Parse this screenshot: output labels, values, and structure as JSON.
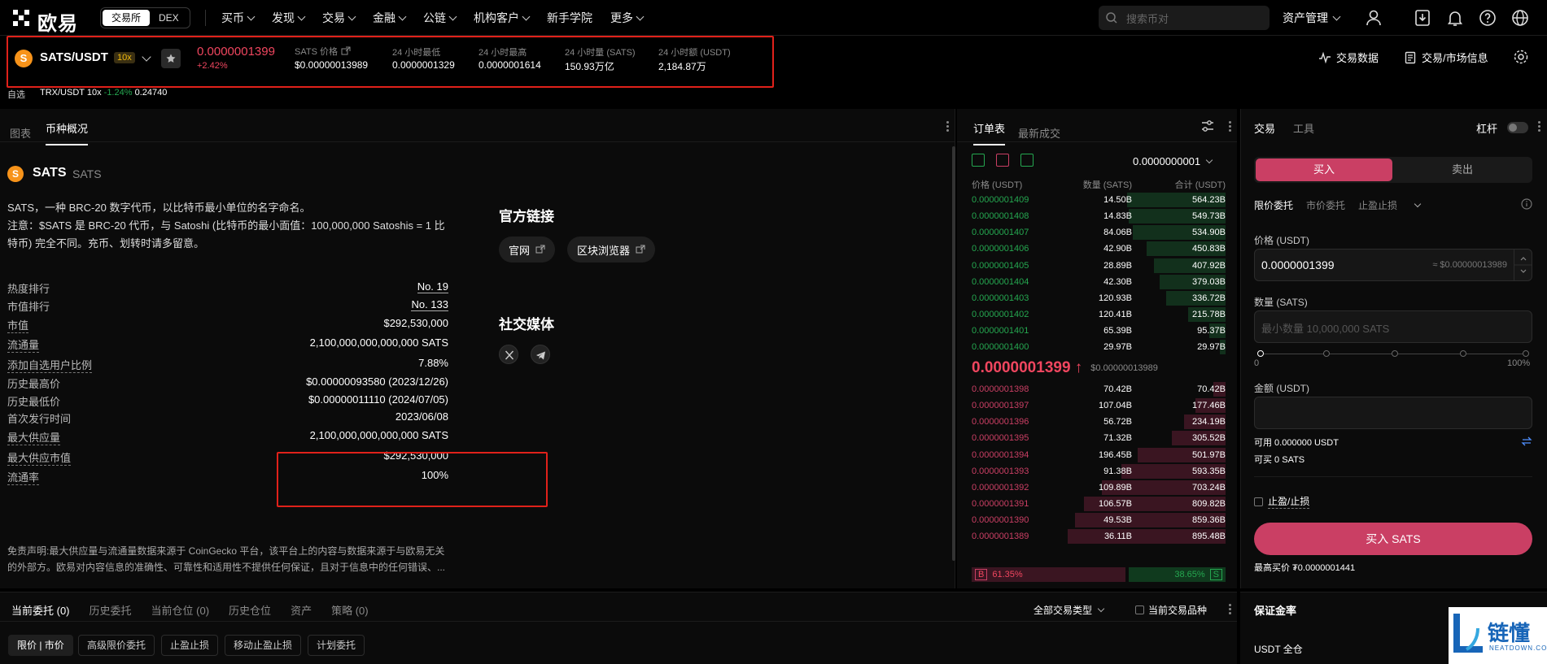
{
  "nav": {
    "logo_text": "欧易",
    "segment": [
      "交易所",
      "DEX"
    ],
    "menu": [
      {
        "label": "买币",
        "dropdown": true
      },
      {
        "label": "发现",
        "dropdown": true
      },
      {
        "label": "交易",
        "dropdown": true
      },
      {
        "label": "金融",
        "dropdown": true
      },
      {
        "label": "公链",
        "dropdown": true
      },
      {
        "label": "机构客户",
        "dropdown": true
      },
      {
        "label": "新手学院",
        "dropdown": false
      },
      {
        "label": "更多",
        "dropdown": true
      }
    ],
    "search_placeholder": "搜索币对",
    "asset_label": "资产管理",
    "icons": [
      "user-icon",
      "download-icon",
      "bell-icon",
      "help-icon",
      "globe-icon"
    ]
  },
  "ticker": {
    "pair": "SATS/USDT",
    "leverage": "10x",
    "last_price": "0.0000001399",
    "change": "+2.42%",
    "stats": [
      {
        "label": "SATS 价格",
        "value": "$0.00000013989"
      },
      {
        "label": "24 小时最低",
        "value": "0.0000001329"
      },
      {
        "label": "24 小时最高",
        "value": "0.0000001614"
      },
      {
        "label": "24 小时量 (SATS)",
        "value": "150.93万亿"
      },
      {
        "label": "24 小时额 (USDT)",
        "value": "2,184.87万"
      }
    ],
    "trade_data_label": "交易数据",
    "market_info_label": "交易/市场信息",
    "highlight_color": "#e0211a"
  },
  "favorites": {
    "label": "自选",
    "item_pair": "TRX/USDT 10x",
    "item_change": "-1.24%",
    "item_price": "0.24740"
  },
  "left": {
    "tabs": [
      "图表",
      "币种概况"
    ],
    "active_tab": 1,
    "coin_name": "SATS",
    "coin_sub": "SATS",
    "desc1": "SATS，一种 BRC-20 数字代币，以比特币最小单位的名字命名。",
    "desc2": "注意：$SATS 是 BRC-20 代币，与 Satoshi (比特币的最小面值：100,000,000 Satoshis = 1 比特币) 完全不同。充币、划转时请多留意。",
    "stats": [
      {
        "k": "热度排行",
        "v": "No. 19",
        "link": true
      },
      {
        "k": "市值排行",
        "v": "No. 133",
        "link": true
      },
      {
        "k": "市值",
        "v": "$292,530,000",
        "link": false
      },
      {
        "k": "流通量",
        "v": "2,100,000,000,000,000 SATS",
        "link": false
      },
      {
        "k": "添加自选用户比例",
        "v": "7.88%",
        "link": false
      },
      {
        "k": "历史最高价",
        "v": "$0.00000093580 (2023/12/26)",
        "link": false
      },
      {
        "k": "历史最低价",
        "v": "$0.00000011110 (2024/07/05)",
        "link": false
      },
      {
        "k": "首次发行时间",
        "v": "2023/06/08",
        "link": false
      },
      {
        "k": "最大供应量",
        "v": "2,100,000,000,000,000 SATS",
        "link": false
      },
      {
        "k": "最大供应市值",
        "v": "$292,530,000",
        "link": false
      },
      {
        "k": "流通率",
        "v": "100%",
        "link": false
      }
    ],
    "disclaimer": "免责声明:最大供应量与流通量数据来源于 CoinGecko 平台，该平台上的内容与数据来源于与欧易无关的外部方。欧易对内容信息的准确性、可靠性和适用性不提供任何保证，且对于信息中的任何错误、...",
    "official_title": "官方链接",
    "links": [
      "官网",
      "区块浏览器"
    ],
    "social_title": "社交媒体",
    "social_icons": [
      "x-icon",
      "telegram-icon"
    ]
  },
  "orderbook": {
    "tabs": [
      "订单表",
      "最新成交"
    ],
    "tick": "0.0000000001",
    "headers": [
      "价格 (USDT)",
      "数量 (SATS)",
      "合计 (USDT)"
    ],
    "asks": [
      {
        "p": "0.0000001409",
        "q": "14.50B",
        "t": "564.23B",
        "depth": 0.55
      },
      {
        "p": "0.0000001408",
        "q": "14.83B",
        "t": "549.73B",
        "depth": 0.54
      },
      {
        "p": "0.0000001407",
        "q": "84.06B",
        "t": "534.90B",
        "depth": 0.52
      },
      {
        "p": "0.0000001406",
        "q": "42.90B",
        "t": "450.83B",
        "depth": 0.44
      },
      {
        "p": "0.0000001405",
        "q": "28.89B",
        "t": "407.92B",
        "depth": 0.4
      },
      {
        "p": "0.0000001404",
        "q": "42.30B",
        "t": "379.03B",
        "depth": 0.37
      },
      {
        "p": "0.0000001403",
        "q": "120.93B",
        "t": "336.72B",
        "depth": 0.33
      },
      {
        "p": "0.0000001402",
        "q": "120.41B",
        "t": "215.78B",
        "depth": 0.21
      },
      {
        "p": "0.0000001401",
        "q": "65.39B",
        "t": "95.37B",
        "depth": 0.09
      },
      {
        "p": "0.0000001400",
        "q": "29.97B",
        "t": "29.97B",
        "depth": 0.03
      }
    ],
    "mid_price": "0.0000001399 ↑",
    "mid_usd": "$0.00000013989",
    "bids": [
      {
        "p": "0.0000001398",
        "q": "70.42B",
        "t": "70.42B",
        "depth": 0.07
      },
      {
        "p": "0.0000001397",
        "q": "107.04B",
        "t": "177.46B",
        "depth": 0.17
      },
      {
        "p": "0.0000001396",
        "q": "56.72B",
        "t": "234.19B",
        "depth": 0.23
      },
      {
        "p": "0.0000001395",
        "q": "71.32B",
        "t": "305.52B",
        "depth": 0.3
      },
      {
        "p": "0.0000001394",
        "q": "196.45B",
        "t": "501.97B",
        "depth": 0.49
      },
      {
        "p": "0.0000001393",
        "q": "91.38B",
        "t": "593.35B",
        "depth": 0.58
      },
      {
        "p": "0.0000001392",
        "q": "109.89B",
        "t": "703.24B",
        "depth": 0.69
      },
      {
        "p": "0.0000001391",
        "q": "106.57B",
        "t": "809.82B",
        "depth": 0.79
      },
      {
        "p": "0.0000001390",
        "q": "49.53B",
        "t": "859.36B",
        "depth": 0.84
      },
      {
        "p": "0.0000001389",
        "q": "36.11B",
        "t": "895.48B",
        "depth": 0.88
      }
    ],
    "buy_label": "B",
    "buy_ratio": "61.35%",
    "buy_ratio_value": 0.6135,
    "sell_ratio": "38.65%",
    "sell_label": "S"
  },
  "trade": {
    "tabs": [
      "交易",
      "工具"
    ],
    "leverage_label": "杠杆",
    "buy": "买入",
    "sell": "卖出",
    "order_types": [
      "限价委托",
      "市价委托",
      "止盈止损"
    ],
    "price_label": "价格 (USDT)",
    "price_value": "0.0000001399",
    "price_equiv": "≈ $0.00000013989",
    "qty_label": "数量 (SATS)",
    "qty_placeholder": "最小数量 10,000,000 SATS",
    "slider_min": "0",
    "slider_max": "100%",
    "amount_label": "金额 (USDT)",
    "avail": "可用 0.000000 USDT",
    "can_buy": "可买 0 SATS",
    "tpsl_label": "止盈/止损",
    "buy_button": "买入 SATS",
    "max_buy": "最高买价 ₮0.0000001441",
    "accent_buy": "#ca3f64",
    "accent_sell": "#25a750"
  },
  "bottom": {
    "tabs": [
      "当前委托 (0)",
      "历史委托",
      "当前仓位 (0)",
      "历史仓位",
      "资产",
      "策略 (0)"
    ],
    "filter_all": "全部交易类型",
    "current_only": "当前交易品种",
    "chips": [
      "限价 | 市价",
      "高级限价委托",
      "止盈止损",
      "移动止盈止损",
      "计划委托"
    ],
    "margin_title": "保证金率",
    "usdt_all": "USDT 全仓"
  },
  "watermark": {
    "text": "链懂",
    "sub": "NEATDOWN.COM"
  }
}
